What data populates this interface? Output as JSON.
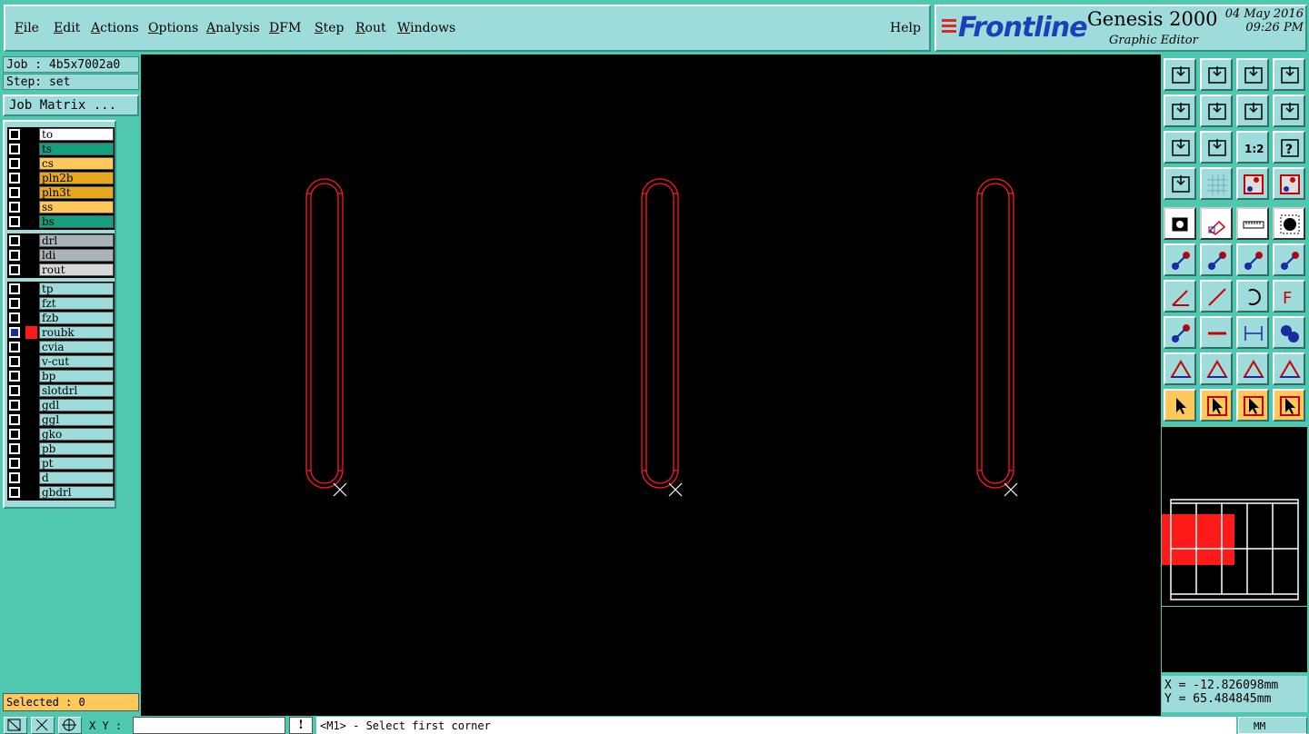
{
  "menu": {
    "items": [
      {
        "first": "F",
        "rest": "ile"
      },
      {
        "first": "E",
        "rest": "dit"
      },
      {
        "first": "A",
        "rest": "ctions"
      },
      {
        "first": "O",
        "rest": "ptions"
      },
      {
        "first": "A",
        "rest": "nalysis"
      },
      {
        "first": "D",
        "rest": "FM"
      },
      {
        "first": "S",
        "rest": "tep"
      },
      {
        "first": "R",
        "rest": "out"
      },
      {
        "first": "W",
        "rest": "indows"
      }
    ],
    "help": "Help"
  },
  "brand": {
    "logo": "Frontline",
    "product": "Genesis 2000",
    "subtitle": "Graphic Editor",
    "date": "04 May 2016",
    "time": "09:26 PM"
  },
  "job": {
    "job_line": "Job : 4b5x7002a0",
    "step_line": "Step: set",
    "matrix_button": "Job Matrix ..."
  },
  "layers": {
    "groups": [
      [
        {
          "name": "to",
          "color": "#ffffff",
          "active": false
        },
        {
          "name": "ts",
          "color": "#14a07c",
          "active": false
        },
        {
          "name": "cs",
          "color": "#ffc85a",
          "active": false
        },
        {
          "name": "pln2b",
          "color": "#e6a81e",
          "active": false
        },
        {
          "name": "pln3t",
          "color": "#e6a81e",
          "active": false
        },
        {
          "name": "ss",
          "color": "#ffc85a",
          "active": false
        },
        {
          "name": "bs",
          "color": "#14a07c",
          "active": false
        }
      ],
      [
        {
          "name": "drl",
          "color": "#a8b4b8",
          "active": false
        },
        {
          "name": "ldi",
          "color": "#a8b4b8",
          "active": false
        },
        {
          "name": "rout",
          "color": "#d8d8d8",
          "active": false
        }
      ],
      [
        {
          "name": "tp",
          "color": "#9edcdc",
          "active": false
        },
        {
          "name": "fzt",
          "color": "#9edcdc",
          "active": false
        },
        {
          "name": "fzb",
          "color": "#9edcdc",
          "active": false
        },
        {
          "name": "roubk",
          "color": "#9edcdc",
          "active": true
        },
        {
          "name": "cvia",
          "color": "#9edcdc",
          "active": false
        },
        {
          "name": "v-cut",
          "color": "#9edcdc",
          "active": false
        },
        {
          "name": "bp",
          "color": "#9edcdc",
          "active": false
        },
        {
          "name": "slotdrl",
          "color": "#9edcdc",
          "active": false
        },
        {
          "name": "gdl",
          "color": "#9edcdc",
          "active": false
        },
        {
          "name": "ggl",
          "color": "#9edcdc",
          "active": false
        },
        {
          "name": "gko",
          "color": "#9edcdc",
          "active": false
        },
        {
          "name": "pb",
          "color": "#9edcdc",
          "active": false
        },
        {
          "name": "pt",
          "color": "#9edcdc",
          "active": false
        },
        {
          "name": "d",
          "color": "#9edcdc",
          "active": false
        },
        {
          "name": "gbdrl",
          "color": "#9edcdc",
          "active": false
        }
      ]
    ],
    "active_color": "#ff1a1a"
  },
  "selected": "Selected : 0",
  "coords": {
    "x": "X = -12.826098mm",
    "y": "Y = 65.484845mm"
  },
  "status": {
    "xy_label": "X Y :",
    "xy_value": "",
    "excl": "!",
    "prompt": "<M1> - Select first corner",
    "units": "MM"
  },
  "colors": {
    "outline": "#ff1a1a",
    "panel": "#9edcdc",
    "background": "#4fc8b0"
  }
}
